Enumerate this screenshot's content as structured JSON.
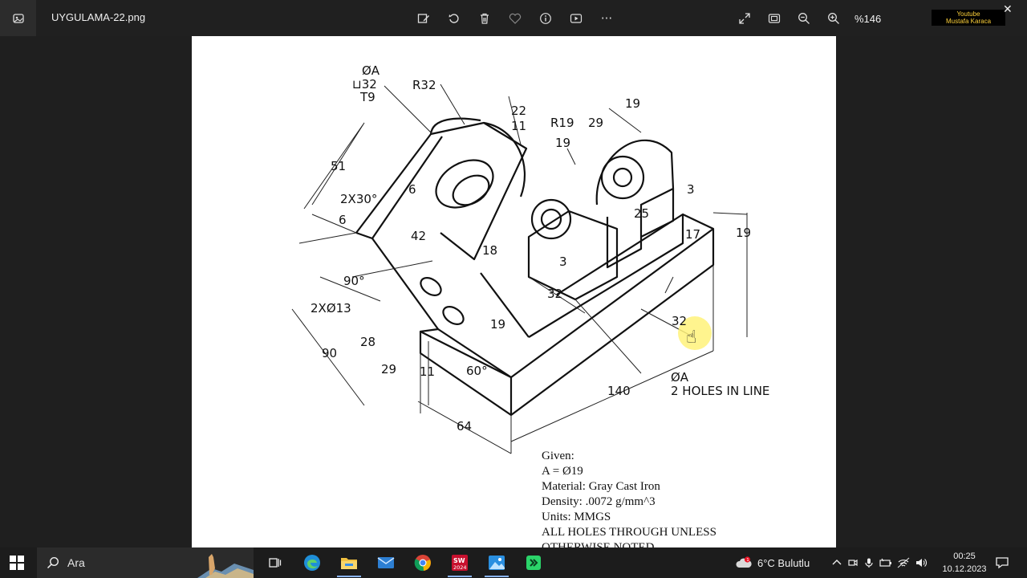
{
  "window": {
    "filename": "UYGULAMA-22.png",
    "zoom_label": "%146",
    "watermark_line1": "Youtube",
    "watermark_line2": "Mustafa Karaca",
    "close_glyph": "✕",
    "more_glyph": "···"
  },
  "toolbar": {
    "icons": [
      "edit-image-icon",
      "rotate-icon",
      "delete-icon",
      "favorite-icon",
      "info-icon",
      "slideshow-icon",
      "more-icon"
    ],
    "right_icons": [
      "expand-icon",
      "fit-icon",
      "zoom-out-icon",
      "zoom-in-icon"
    ]
  },
  "drawing": {
    "labels": {
      "phiA_top": "ØA",
      "cbore": "⊔32",
      "depth": "T9",
      "r32": "R32",
      "d22": "22",
      "d11_top": "11",
      "r19": "R19",
      "d29": "29",
      "d19_top": "19",
      "d19_mid": "19",
      "d51": "51",
      "chamfer": "2X30°",
      "d6_a": "6",
      "d6_b": "6",
      "d42": "42",
      "d18": "18",
      "d25": "25",
      "d3_right": "3",
      "d3_mid": "3",
      "d17": "17",
      "d19_right": "19",
      "d90deg": "90°",
      "holes13": "2XØ13",
      "d32_a": "32",
      "d32_b": "32",
      "d19_low": "19",
      "d28": "28",
      "d29_low": "29",
      "d90": "90",
      "d11_low": "11",
      "d60deg": "60°",
      "phiA_bottom": "ØA",
      "holes_in_line": "2 HOLES IN LINE",
      "d140": "140",
      "d64": "64"
    },
    "given": [
      "Given:",
      "A = Ø19",
      "Material: Gray Cast Iron",
      "Density: .0072 g/mm^3",
      "Units: MMGS",
      "ALL HOLES THROUGH UNLESS",
      "OTHERWISE NOTED"
    ]
  },
  "taskbar": {
    "search_label": "Ara",
    "apps": [
      "task-view-icon",
      "edge-icon",
      "file-explorer-icon",
      "mail-icon",
      "chrome-icon",
      "solidworks-icon",
      "photos-icon",
      "screen-recorder-icon"
    ],
    "solidworks_year": "2024",
    "weather": "6°C  Bulutlu",
    "weather_badge": "1",
    "time": "00:25",
    "date": "10.12.2023"
  },
  "colors": {
    "window_bg": "#202020",
    "canvas_bg": "#ffffff",
    "taskbar_bg": "#1c1c1c",
    "cursor_highlight": "#fff27a",
    "badge_red": "#e81123"
  }
}
